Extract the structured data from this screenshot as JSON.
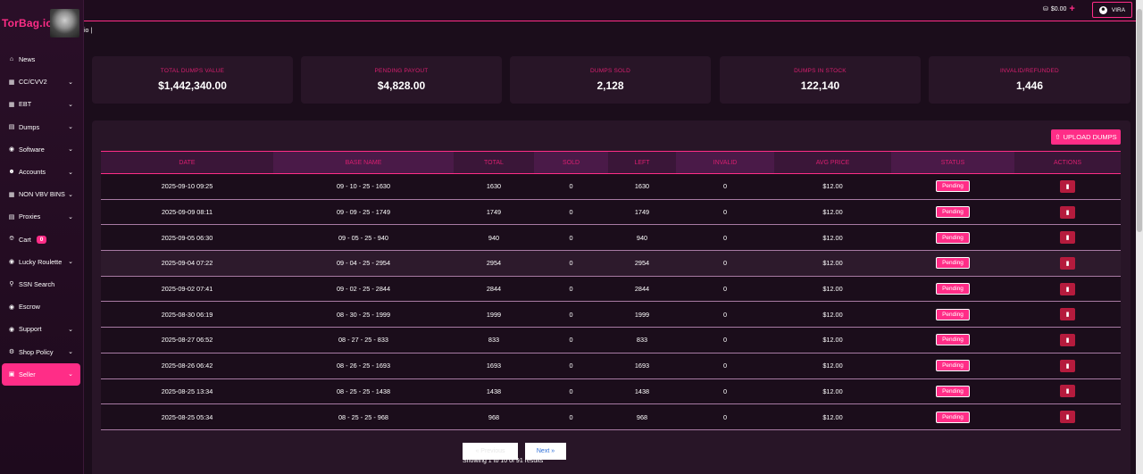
{
  "brand": {
    "name": "TorBag.io"
  },
  "breadcrumb": "io |",
  "header": {
    "balance": "$0.00",
    "user": "VIRA"
  },
  "sidebar": {
    "items": [
      {
        "label": "News",
        "icon": "home-icon",
        "chevron": false
      },
      {
        "label": "CC/CVV2",
        "icon": "card-icon",
        "chevron": true
      },
      {
        "label": "EBT",
        "icon": "ebt-icon",
        "chevron": true
      },
      {
        "label": "Dumps",
        "icon": "dumps-icon",
        "chevron": true
      },
      {
        "label": "Software",
        "icon": "software-icon",
        "chevron": true
      },
      {
        "label": "Accounts",
        "icon": "accounts-icon",
        "chevron": true
      },
      {
        "label": "NON VBV BINS",
        "icon": "bins-icon",
        "chevron": true
      },
      {
        "label": "Proxies",
        "icon": "proxies-icon",
        "chevron": true
      },
      {
        "label": "Cart",
        "icon": "cart-icon",
        "chevron": false,
        "badge": "0"
      },
      {
        "label": "Lucky Roulette",
        "icon": "roulette-icon",
        "chevron": true
      },
      {
        "label": "SSN Search",
        "icon": "ssn-icon",
        "chevron": false
      },
      {
        "label": "Escrow",
        "icon": "escrow-icon",
        "chevron": false
      },
      {
        "label": "Support",
        "icon": "support-icon",
        "chevron": true
      },
      {
        "label": "Shop Policy",
        "icon": "policy-icon",
        "chevron": true
      },
      {
        "label": "Seller",
        "icon": "seller-icon",
        "chevron": true,
        "active": true
      }
    ]
  },
  "stats": [
    {
      "label": "TOTAL DUMPS VALUE",
      "value": "$1,442,340.00"
    },
    {
      "label": "PENDING PAYOUT",
      "value": "$4,828.00"
    },
    {
      "label": "DUMPS SOLD",
      "value": "2,128"
    },
    {
      "label": "DUMPS IN STOCK",
      "value": "122,140"
    },
    {
      "label": "INVALID/REFUNDED",
      "value": "1,446"
    }
  ],
  "upload_label": "UPLOAD DUMPS",
  "table": {
    "headers": [
      "DATE",
      "BASE NAME",
      "TOTAL",
      "SOLD",
      "LEFT",
      "INVALID",
      "AVG PRICE",
      "STATUS",
      "ACTIONS"
    ],
    "rows": [
      {
        "date": "2025-09-10 09:25",
        "base": "09 - 10 - 25 - 1630",
        "total": "1630",
        "sold": "0",
        "left": "1630",
        "invalid": "0",
        "price": "$12.00",
        "status": "Pending"
      },
      {
        "date": "2025-09-09 08:11",
        "base": "09 - 09 - 25 - 1749",
        "total": "1749",
        "sold": "0",
        "left": "1749",
        "invalid": "0",
        "price": "$12.00",
        "status": "Pending"
      },
      {
        "date": "2025-09-05 06:30",
        "base": "09 - 05 - 25 - 940",
        "total": "940",
        "sold": "0",
        "left": "940",
        "invalid": "0",
        "price": "$12.00",
        "status": "Pending"
      },
      {
        "date": "2025-09-04 07:22",
        "base": "09 - 04 - 25 - 2954",
        "total": "2954",
        "sold": "0",
        "left": "2954",
        "invalid": "0",
        "price": "$12.00",
        "status": "Pending"
      },
      {
        "date": "2025-09-02 07:41",
        "base": "09 - 02 - 25 - 2844",
        "total": "2844",
        "sold": "0",
        "left": "2844",
        "invalid": "0",
        "price": "$12.00",
        "status": "Pending"
      },
      {
        "date": "2025-08-30 06:19",
        "base": "08 - 30 - 25 - 1999",
        "total": "1999",
        "sold": "0",
        "left": "1999",
        "invalid": "0",
        "price": "$12.00",
        "status": "Pending"
      },
      {
        "date": "2025-08-27 06:52",
        "base": "08 - 27 - 25 - 833",
        "total": "833",
        "sold": "0",
        "left": "833",
        "invalid": "0",
        "price": "$12.00",
        "status": "Pending"
      },
      {
        "date": "2025-08-26 06:42",
        "base": "08 - 26 - 25 - 1693",
        "total": "1693",
        "sold": "0",
        "left": "1693",
        "invalid": "0",
        "price": "$12.00",
        "status": "Pending"
      },
      {
        "date": "2025-08-25 13:34",
        "base": "08 - 25 - 25 - 1438",
        "total": "1438",
        "sold": "0",
        "left": "1438",
        "invalid": "0",
        "price": "$12.00",
        "status": "Pending"
      },
      {
        "date": "2025-08-25 05:34",
        "base": "08 - 25 - 25 - 968",
        "total": "968",
        "sold": "0",
        "left": "968",
        "invalid": "0",
        "price": "$12.00",
        "status": "Pending"
      }
    ]
  },
  "pagination": {
    "prev": "« Previous",
    "next": "Next »",
    "info": "Showing 1 to 10 of 91 results"
  },
  "colors": {
    "accent": "#ff2d87",
    "background": "#1b0d1b",
    "card": "#281527",
    "delete": "#b51b3d"
  }
}
